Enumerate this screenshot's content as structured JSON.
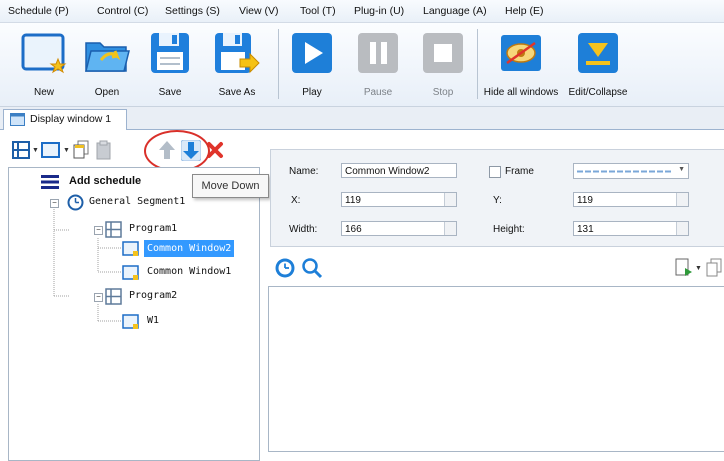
{
  "menubar": {
    "items": [
      "Schedule (P)",
      "Control (C)",
      "Settings (S)",
      "View (V)",
      "Tool (T)",
      "Plug-in (U)",
      "Language (A)",
      "Help (E)"
    ]
  },
  "toolbar": {
    "buttons": [
      {
        "label": "New",
        "icon": "new-icon",
        "enabled": true
      },
      {
        "label": "Open",
        "icon": "open-folder-icon",
        "enabled": true
      },
      {
        "label": "Save",
        "icon": "save-icon",
        "enabled": true
      },
      {
        "label": "Save As",
        "icon": "save-as-icon",
        "enabled": true
      },
      {
        "label": "Play",
        "icon": "play-icon",
        "enabled": true
      },
      {
        "label": "Pause",
        "icon": "pause-icon",
        "enabled": false
      },
      {
        "label": "Stop",
        "icon": "stop-icon",
        "enabled": false
      },
      {
        "label": "Hide all windows",
        "icon": "hide-windows-icon",
        "enabled": true
      },
      {
        "label": "Edit/Collapse",
        "icon": "edit-collapse-icon",
        "enabled": true
      }
    ]
  },
  "tabs": [
    {
      "label": "Display window 1",
      "active": true
    }
  ],
  "tree": {
    "add_schedule": "Add schedule",
    "segment": "General Segment1",
    "program1": "Program1",
    "window2": "Common Window2",
    "window1": "Common Window1",
    "program2": "Program2",
    "w1": "W1",
    "selected": "Common Window2"
  },
  "tooltip": {
    "text": "Move Down"
  },
  "properties": {
    "name_label": "Name:",
    "name_value": "Common Window2",
    "frame_label": "Frame",
    "frame_checked": false,
    "x_label": "X:",
    "x_value": "119",
    "y_label": "Y:",
    "y_value": "119",
    "width_label": "Width:",
    "width_value": "166",
    "height_label": "Height:",
    "height_value": "131"
  },
  "colors": {
    "accent_blue": "#1e7fd8",
    "selection": "#3399ff",
    "highlight_circle": "#d9302a",
    "delete_red": "#e0342b"
  }
}
